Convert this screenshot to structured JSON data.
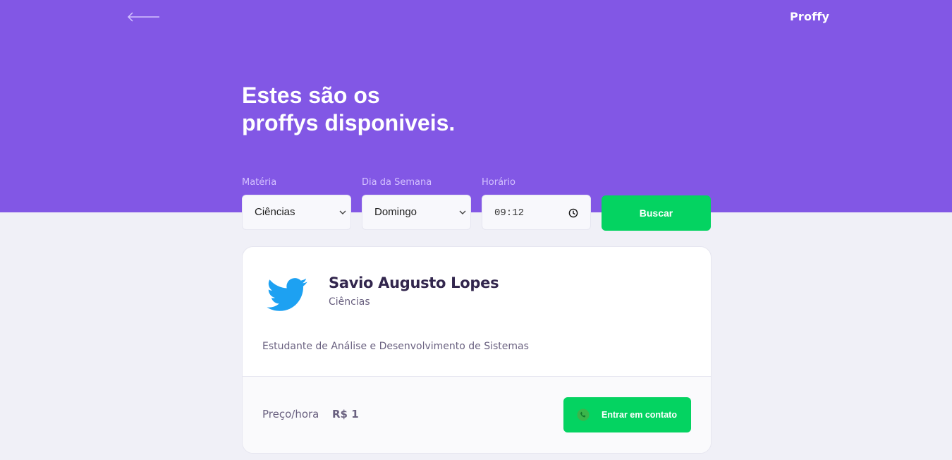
{
  "header": {
    "logo": "Proffy",
    "back_icon": "arrow-left-icon",
    "title_line1": "Estes são os",
    "title_line2": "proffys disponiveis."
  },
  "filters": {
    "subject": {
      "label": "Matéria",
      "value": "Ciências"
    },
    "weekday": {
      "label": "Dia da Semana",
      "value": "Domingo"
    },
    "time": {
      "label": "Horário",
      "value": "09:12"
    },
    "search_button": "Buscar"
  },
  "teacher": {
    "name": "Savio Augusto Lopes",
    "subject": "Ciências",
    "bio": "Estudante de Análise e Desenvolvimento de Sistemas",
    "avatar_icon": "twitter-bird-icon",
    "price_label": "Preço/hora",
    "price_value": "R$ 1",
    "contact_button": "Entrar em contato",
    "contact_icon": "whatsapp-icon"
  },
  "colors": {
    "primary": "#8257E5",
    "secondary": "#04D361",
    "background": "#F0F0F7",
    "twitter_blue": "#1DA1F2"
  }
}
